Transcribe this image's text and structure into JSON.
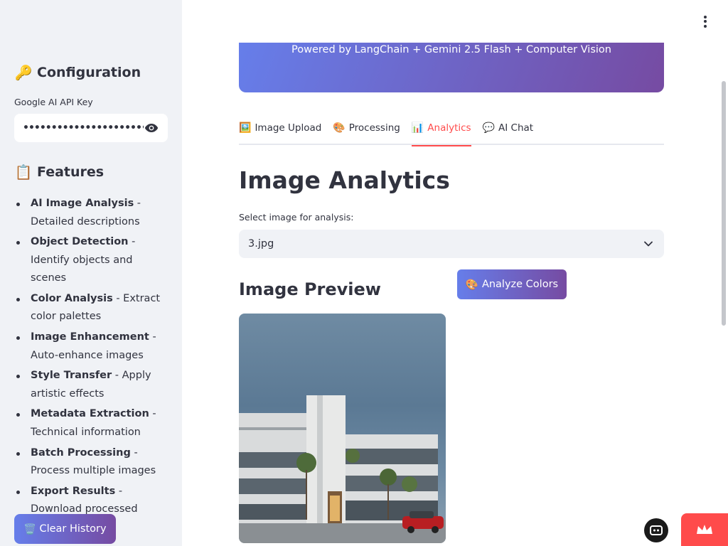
{
  "sidebar": {
    "config_emoji": "🔑",
    "config_title": "Configuration",
    "api_label": "Google AI API Key",
    "api_value": "•••••••••••••••••••••••••••••",
    "features_emoji": "📋",
    "features_title": "Features",
    "features": [
      {
        "name": "AI Image Analysis",
        "desc": " - Detailed descriptions"
      },
      {
        "name": "Object Detection",
        "desc": " - Identify objects and scenes"
      },
      {
        "name": "Color Analysis",
        "desc": " - Extract color palettes"
      },
      {
        "name": "Image Enhancement",
        "desc": " - Auto-enhance images"
      },
      {
        "name": "Style Transfer",
        "desc": " - Apply artistic effects"
      },
      {
        "name": "Metadata Extraction",
        "desc": " - Technical information"
      },
      {
        "name": "Batch Processing",
        "desc": " - Process multiple images"
      },
      {
        "name": "Export Results",
        "desc": " - Download processed images"
      }
    ],
    "clear_emoji": "🗑️",
    "clear_label": "Clear History"
  },
  "banner": {
    "subtitle": "Powered by LangChain + Gemini 2.5 Flash + Computer Vision"
  },
  "tabs": [
    {
      "emoji": "🖼️",
      "label": "Image Upload",
      "active": false
    },
    {
      "emoji": "🎨",
      "label": "Processing",
      "active": false
    },
    {
      "emoji": "📊",
      "label": "Analytics",
      "active": true
    },
    {
      "emoji": "💬",
      "label": "AI Chat",
      "active": false
    }
  ],
  "main": {
    "title": "Image Analytics",
    "select_label": "Select image for analysis:",
    "selected_image": "3.jpg",
    "preview_title": "Image Preview",
    "analyze_emoji": "🎨",
    "analyze_label": "Analyze Colors"
  },
  "colors": {
    "accent": "#ff4b4b",
    "gradient_start": "#667eea",
    "gradient_end": "#764ba2",
    "sidebar_bg": "#f0f2f6"
  }
}
